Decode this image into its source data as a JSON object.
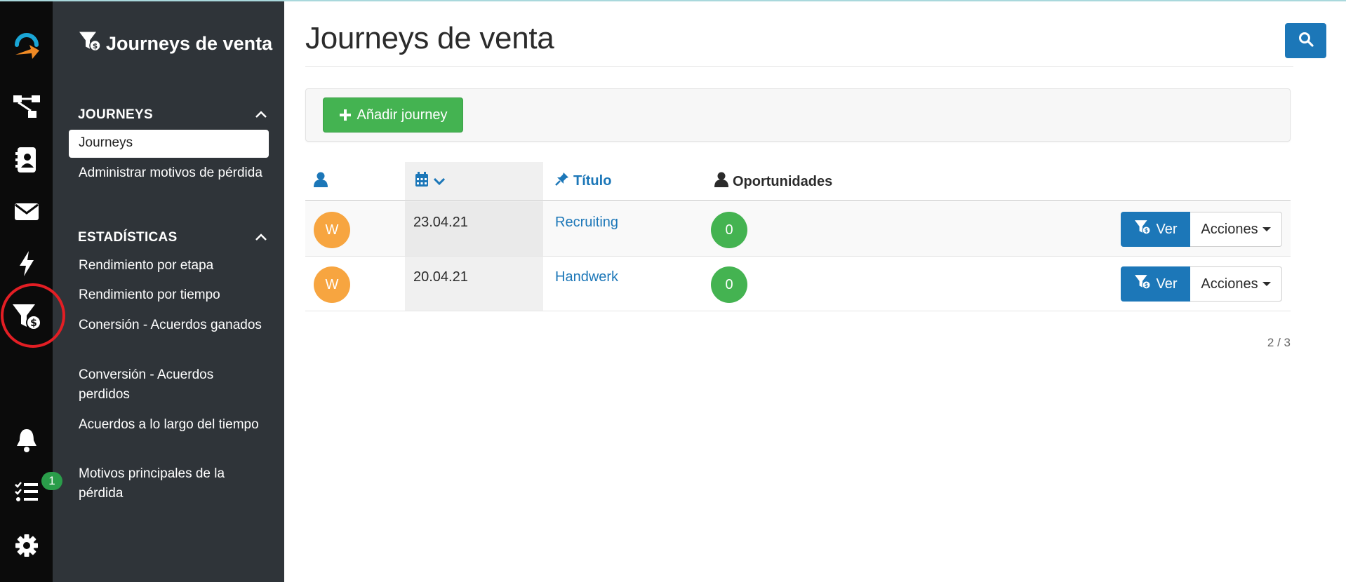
{
  "sidebar": {
    "title": "Journeys de venta",
    "sections": [
      {
        "heading": "JOURNEYS",
        "items": [
          {
            "label": "Journeys",
            "active": true
          },
          {
            "label": "Administrar motivos de pérdida",
            "active": false
          }
        ]
      },
      {
        "heading": "ESTADÍSTICAS",
        "items": [
          {
            "label": "Rendimiento por etapa"
          },
          {
            "label": "Rendimiento por tiempo"
          },
          {
            "label": "Conersión - Acuerdos ganados"
          },
          {
            "label": "Conversión - Acuerdos perdidos"
          },
          {
            "label": "Acuerdos a lo largo del tiempo"
          },
          {
            "label": "Motivos principales de la pérdida"
          }
        ]
      }
    ]
  },
  "rail": {
    "icons": [
      "logo-icon",
      "sitemap-icon",
      "contacts-icon",
      "envelope-icon",
      "bolt-icon",
      "funnel-dollar-icon",
      "bell-icon",
      "tasks-icon",
      "gear-icon"
    ],
    "tasks_badge": "1",
    "highlighted": "funnel-dollar-icon"
  },
  "main": {
    "page_title": "Journeys de venta",
    "add_button_label": "Añadir journey",
    "table": {
      "columns": [
        {
          "key": "owner",
          "label": "",
          "icon": "user-icon"
        },
        {
          "key": "date",
          "label": "",
          "icon": "calendar-icon",
          "sorted": "desc"
        },
        {
          "key": "title",
          "label": "Título",
          "icon": "pin-icon"
        },
        {
          "key": "opportunities",
          "label": "Oportunidades",
          "icon": "user-icon"
        }
      ],
      "rows": [
        {
          "avatar": "W",
          "date": "23.04.21",
          "title": "Recruiting",
          "opportunities": "0",
          "view_label": "Ver",
          "actions_label": "Acciones"
        },
        {
          "avatar": "W",
          "date": "20.04.21",
          "title": "Handwerk",
          "opportunities": "0",
          "view_label": "Ver",
          "actions_label": "Acciones"
        }
      ]
    },
    "pagination": "2 / 3"
  },
  "colors": {
    "primary": "#1c77b8",
    "success": "#44b351",
    "avatar": "#f7a540",
    "sidebar_bg": "#2f3439",
    "rail_bg": "#0b0b0b",
    "highlight_ring": "#e31e24"
  }
}
